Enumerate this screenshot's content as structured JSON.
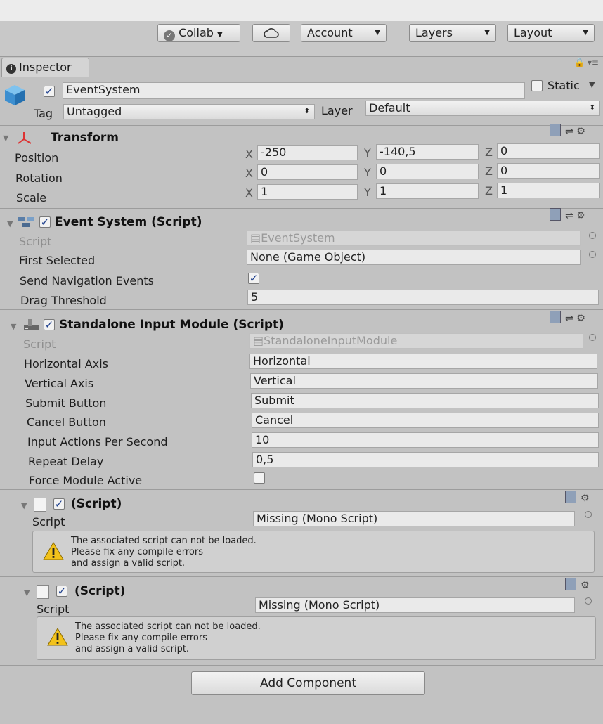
{
  "toolbar": {
    "collab": "Collab",
    "account": "Account",
    "layers": "Layers",
    "layout": "Layout"
  },
  "tab": {
    "label": "Inspector"
  },
  "gameobject": {
    "name": "EventSystem",
    "active": true,
    "static_label": "Static",
    "tag_label": "Tag",
    "tag_value": "Untagged",
    "layer_label": "Layer",
    "layer_value": "Default"
  },
  "transform": {
    "title": "Transform",
    "position_label": "Position",
    "rotation_label": "Rotation",
    "scale_label": "Scale",
    "axis_x": "X",
    "axis_y": "Y",
    "axis_z": "Z",
    "position": {
      "x": "-250",
      "y": "-140,5",
      "z": "0"
    },
    "rotation": {
      "x": "0",
      "y": "0",
      "z": "0"
    },
    "scale": {
      "x": "1",
      "y": "1",
      "z": "1"
    }
  },
  "event_system": {
    "title": "Event System (Script)",
    "script_label": "Script",
    "script_value": "EventSystem",
    "first_selected_label": "First Selected",
    "first_selected_value": "None (Game Object)",
    "send_nav_label": "Send Navigation Events",
    "send_nav_checked": true,
    "drag_threshold_label": "Drag Threshold",
    "drag_threshold_value": "5"
  },
  "input_module": {
    "title": "Standalone Input Module (Script)",
    "script_label": "Script",
    "script_value": "StandaloneInputModule",
    "horizontal_label": "Horizontal Axis",
    "horizontal_value": "Horizontal",
    "vertical_label": "Vertical Axis",
    "vertical_value": "Vertical",
    "submit_label": "Submit Button",
    "submit_value": "Submit",
    "cancel_label": "Cancel Button",
    "cancel_value": "Cancel",
    "ips_label": "Input Actions Per Second",
    "ips_value": "10",
    "repeat_label": "Repeat Delay",
    "repeat_value": "0,5",
    "force_label": "Force Module Active",
    "force_checked": false
  },
  "missing1": {
    "title": "(Script)",
    "script_label": "Script",
    "script_value": "Missing (Mono Script)",
    "message": "The associated script can not be loaded.\nPlease fix any compile errors\nand assign a valid script."
  },
  "missing2": {
    "title": "(Script)",
    "script_label": "Script",
    "script_value": "Missing (Mono Script)",
    "message": "The associated script can not be loaded.\nPlease fix any compile errors\nand assign a valid script."
  },
  "add_component": "Add Component",
  "colors": {
    "panel": "#c2c2c2",
    "field": "#eaeaea",
    "check": "#1b3d8c",
    "warning": "#f2c21b"
  }
}
